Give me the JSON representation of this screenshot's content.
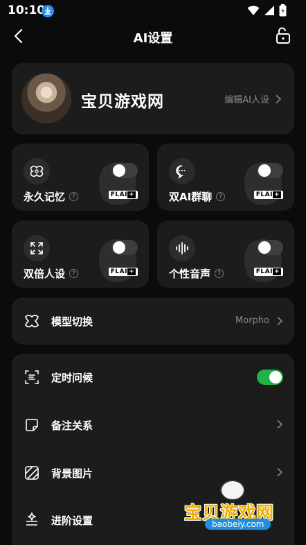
{
  "status": {
    "time": "10:10"
  },
  "header": {
    "title": "AI设置"
  },
  "profile": {
    "name": "宝贝游戏网",
    "edit_label": "编辑AI人设"
  },
  "features": [
    {
      "label": "永久记忆",
      "badge_a": "FLAI",
      "badge_b": "+",
      "enabled": false,
      "icon": "memory-icon"
    },
    {
      "label": "双AI群聊",
      "badge_a": "FLAI",
      "badge_b": "+",
      "enabled": false,
      "icon": "chat-icon"
    },
    {
      "label": "双倍人设",
      "badge_a": "FLAI",
      "badge_b": "+",
      "enabled": false,
      "icon": "expand-icon"
    },
    {
      "label": "个性音声",
      "badge_a": "FLAI",
      "badge_b": "+",
      "enabled": false,
      "icon": "waveform-icon"
    }
  ],
  "model": {
    "label": "模型切换",
    "value": "Morpho"
  },
  "list": [
    {
      "label": "定时问候",
      "toggle": true
    },
    {
      "label": "备注关系"
    },
    {
      "label": "背景图片"
    },
    {
      "label": "进阶设置"
    }
  ],
  "watermark": {
    "text": "宝贝游戏网",
    "url": "baobeiy.com"
  },
  "colors": {
    "toggle_on": "#21b24a",
    "card": "#1c1c1c",
    "background": "#0b0b0b"
  }
}
